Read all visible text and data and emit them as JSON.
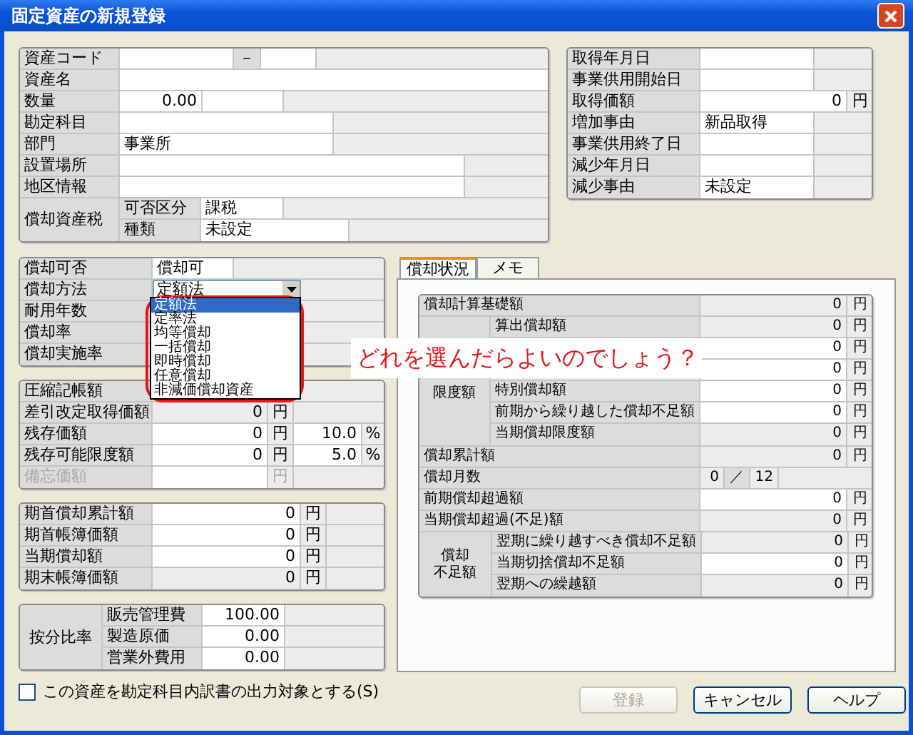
{
  "window": {
    "title": "固定資産の新規登録"
  },
  "asset_info": {
    "rows": [
      {
        "label": "資産コード",
        "cells": [
          {
            "kind": "text",
            "editable": true
          },
          {
            "kind": "sep",
            "text": "－"
          },
          {
            "kind": "text",
            "editable": true
          }
        ]
      },
      {
        "label": "資産名",
        "cells": [
          {
            "kind": "text",
            "editable": true
          }
        ]
      },
      {
        "label": "数量",
        "cells": [
          {
            "kind": "amount",
            "editable": true,
            "text": "0.00"
          },
          {
            "kind": "text",
            "editable": true
          }
        ]
      },
      {
        "label": "勘定科目",
        "cells": [
          {
            "kind": "text",
            "editable": true
          }
        ]
      },
      {
        "label": "部門",
        "cells": [
          {
            "kind": "text",
            "editable": true,
            "text": "事業所"
          }
        ]
      },
      {
        "label": "設置場所",
        "cells": [
          {
            "kind": "text",
            "editable": true
          }
        ]
      },
      {
        "label": "地区情報",
        "cells": [
          {
            "kind": "text",
            "editable": true
          }
        ]
      },
      {
        "label": "償却資産税",
        "group": [
          {
            "label": "可否区分",
            "cells": [
              {
                "kind": "text",
                "editable": true,
                "text": "課税"
              }
            ]
          },
          {
            "label": "種類",
            "cells": [
              {
                "kind": "text",
                "editable": true,
                "text": "未設定"
              }
            ]
          }
        ]
      }
    ]
  },
  "acquisition": {
    "rows": [
      {
        "label": "取得年月日",
        "cells": [
          {
            "kind": "text",
            "editable": true
          }
        ]
      },
      {
        "label": "事業供用開始日",
        "cells": [
          {
            "kind": "text",
            "editable": true
          }
        ]
      },
      {
        "label": "取得価額",
        "cells": [
          {
            "kind": "amount",
            "editable": true,
            "text": "0"
          },
          {
            "kind": "unit",
            "text": "円"
          }
        ]
      },
      {
        "label": "増加事由",
        "cells": [
          {
            "kind": "text",
            "editable": true,
            "text": "新品取得"
          }
        ]
      },
      {
        "label": "事業供用終了日",
        "cells": [
          {
            "kind": "text",
            "editable": true
          }
        ]
      },
      {
        "label": "減少年月日",
        "cells": [
          {
            "kind": "text",
            "editable": true
          }
        ]
      },
      {
        "label": "減少事由",
        "cells": [
          {
            "kind": "text",
            "editable": true,
            "text": "未設定"
          }
        ]
      }
    ]
  },
  "depreciation_method": {
    "rows": [
      {
        "label": "償却可否",
        "cells": [
          {
            "kind": "text",
            "editable": true,
            "text": "償却可"
          }
        ]
      },
      {
        "label": "償却方法",
        "cells": [
          {
            "kind": "select",
            "text": "定額法"
          }
        ]
      },
      {
        "label": "耐用年数",
        "cells": []
      },
      {
        "label": "償却率",
        "cells": []
      },
      {
        "label": "償却実施率",
        "cells": []
      }
    ]
  },
  "method_options": {
    "items": [
      {
        "label": "定額法",
        "selected": true
      },
      {
        "label": "定率法",
        "selected": false
      },
      {
        "label": "均等償却",
        "selected": false
      },
      {
        "label": "一括償却",
        "selected": false
      },
      {
        "label": "即時償却",
        "selected": false
      },
      {
        "label": "任意償却",
        "selected": false
      },
      {
        "label": "非減価償却資産",
        "selected": false
      }
    ]
  },
  "residual": {
    "rows": [
      {
        "label": "圧縮記帳額",
        "cells": []
      },
      {
        "label": "差引改定取得価額",
        "cells": [
          {
            "kind": "amount",
            "editable": false,
            "text": "0"
          },
          {
            "kind": "unit",
            "text": "円"
          }
        ]
      },
      {
        "label": "残存価額",
        "cells": [
          {
            "kind": "amount",
            "editable": true,
            "text": "0"
          },
          {
            "kind": "unit",
            "text": "円"
          },
          {
            "kind": "amount",
            "editable": true,
            "text": "10.0"
          },
          {
            "kind": "unit",
            "text": "%"
          }
        ]
      },
      {
        "label": "残存可能限度額",
        "cells": [
          {
            "kind": "amount",
            "editable": true,
            "text": "0"
          },
          {
            "kind": "unit",
            "text": "円"
          },
          {
            "kind": "amount",
            "editable": true,
            "text": "5.0"
          },
          {
            "kind": "unit",
            "text": "%"
          }
        ]
      },
      {
        "label": "備忘価額",
        "disabled": true,
        "cells": [
          {
            "kind": "amount",
            "editable": true
          },
          {
            "kind": "unit",
            "text": "円"
          }
        ]
      }
    ]
  },
  "book_values": {
    "rows": [
      {
        "label": "期首償却累計額",
        "cells": [
          {
            "kind": "amount",
            "editable": true,
            "text": "0"
          },
          {
            "kind": "unit",
            "text": "円"
          }
        ]
      },
      {
        "label": "期首帳簿価額",
        "cells": [
          {
            "kind": "amount",
            "editable": true,
            "text": "0"
          },
          {
            "kind": "unit",
            "text": "円"
          }
        ]
      },
      {
        "label": "当期償却額",
        "cells": [
          {
            "kind": "amount",
            "editable": true,
            "text": "0"
          },
          {
            "kind": "unit",
            "text": "円"
          }
        ]
      },
      {
        "label": "期末帳簿価額",
        "cells": [
          {
            "kind": "amount",
            "editable": false,
            "text": "0"
          },
          {
            "kind": "unit",
            "text": "円"
          }
        ]
      }
    ]
  },
  "allocation": {
    "rows": [
      {
        "label": "按分比率",
        "group": [
          {
            "label": "販売管理費",
            "cells": [
              {
                "kind": "amount",
                "editable": true,
                "text": "100.00"
              }
            ]
          },
          {
            "label": "製造原価",
            "cells": [
              {
                "kind": "amount",
                "editable": true,
                "text": "0.00"
              }
            ]
          },
          {
            "label": "営業外費用",
            "cells": [
              {
                "kind": "amount",
                "editable": true,
                "text": "0.00"
              }
            ]
          }
        ]
      }
    ]
  },
  "output_option": {
    "label": "この資産を勘定科目内訳書の出力対象とする(S)",
    "checked": false
  },
  "status_tabs": [
    {
      "label": "償却状況",
      "selected": true
    },
    {
      "label": "メモ",
      "selected": false
    }
  ],
  "depreciation_status": {
    "rows": [
      {
        "label": "償却計算基礎額",
        "cells": [
          {
            "kind": "amount",
            "editable": false,
            "text": "0"
          },
          {
            "kind": "unit",
            "text": "円"
          }
        ]
      },
      {
        "label": "限度額",
        "group": [
          {
            "label": "算出償却額",
            "cells": [
              {
                "kind": "amount",
                "editable": false,
                "text": "0"
              },
              {
                "kind": "unit",
                "text": "円"
              }
            ]
          },
          {
            "cells": [
              {
                "kind": "amount",
                "editable": true,
                "text": "0"
              },
              {
                "kind": "unit",
                "text": "円"
              }
            ]
          },
          {
            "cells": [
              {
                "kind": "amount",
                "editable": true,
                "text": "0"
              },
              {
                "kind": "unit",
                "text": "円"
              }
            ]
          },
          {
            "label": "特別償却額",
            "cells": [
              {
                "kind": "amount",
                "editable": true,
                "text": "0"
              },
              {
                "kind": "unit",
                "text": "円"
              }
            ]
          },
          {
            "label": "前期から繰り越した償却不足額",
            "cells": [
              {
                "kind": "amount",
                "editable": true,
                "text": "0"
              },
              {
                "kind": "unit",
                "text": "円"
              }
            ]
          },
          {
            "label": "当期償却限度額",
            "cells": [
              {
                "kind": "amount",
                "editable": false,
                "text": "0"
              },
              {
                "kind": "unit",
                "text": "円"
              }
            ]
          }
        ]
      },
      {
        "label": "償却累計額",
        "cells": [
          {
            "kind": "amount",
            "editable": false,
            "text": "0"
          },
          {
            "kind": "unit",
            "text": "円"
          }
        ]
      },
      {
        "label": "償却月数",
        "cells": [
          {
            "kind": "amount",
            "editable": false,
            "text": "0"
          },
          {
            "kind": "sep",
            "text": "／"
          },
          {
            "kind": "amount",
            "editable": false,
            "text": "12"
          }
        ]
      },
      {
        "label": "前期償却超過額",
        "cells": [
          {
            "kind": "amount",
            "editable": true,
            "text": "0"
          },
          {
            "kind": "unit",
            "text": "円"
          }
        ]
      },
      {
        "label": "当期償却超過(不足)額",
        "cells": [
          {
            "kind": "amount",
            "editable": false,
            "text": "0"
          },
          {
            "kind": "unit",
            "text": "円"
          }
        ]
      },
      {
        "label_lines": [
          "償却",
          "不足額"
        ],
        "group": [
          {
            "label": "翌期に繰り越すべき償却不足額",
            "cells": [
              {
                "kind": "amount",
                "editable": false,
                "text": "0"
              },
              {
                "kind": "unit",
                "text": "円"
              }
            ]
          },
          {
            "label": "当期切捨償却不足額",
            "cells": [
              {
                "kind": "amount",
                "editable": true,
                "text": "0"
              },
              {
                "kind": "unit",
                "text": "円"
              }
            ]
          },
          {
            "label": "翌期への繰越額",
            "cells": [
              {
                "kind": "amount",
                "editable": false,
                "text": "0"
              },
              {
                "kind": "unit",
                "text": "円"
              }
            ]
          }
        ]
      }
    ]
  },
  "buttons": [
    {
      "label": "登録",
      "disabled": true
    },
    {
      "label": "キャンセル",
      "disabled": false
    },
    {
      "label": "ヘルプ",
      "disabled": false
    }
  ],
  "annotation": {
    "text": "どれを選んだらよいのでしょう？"
  }
}
